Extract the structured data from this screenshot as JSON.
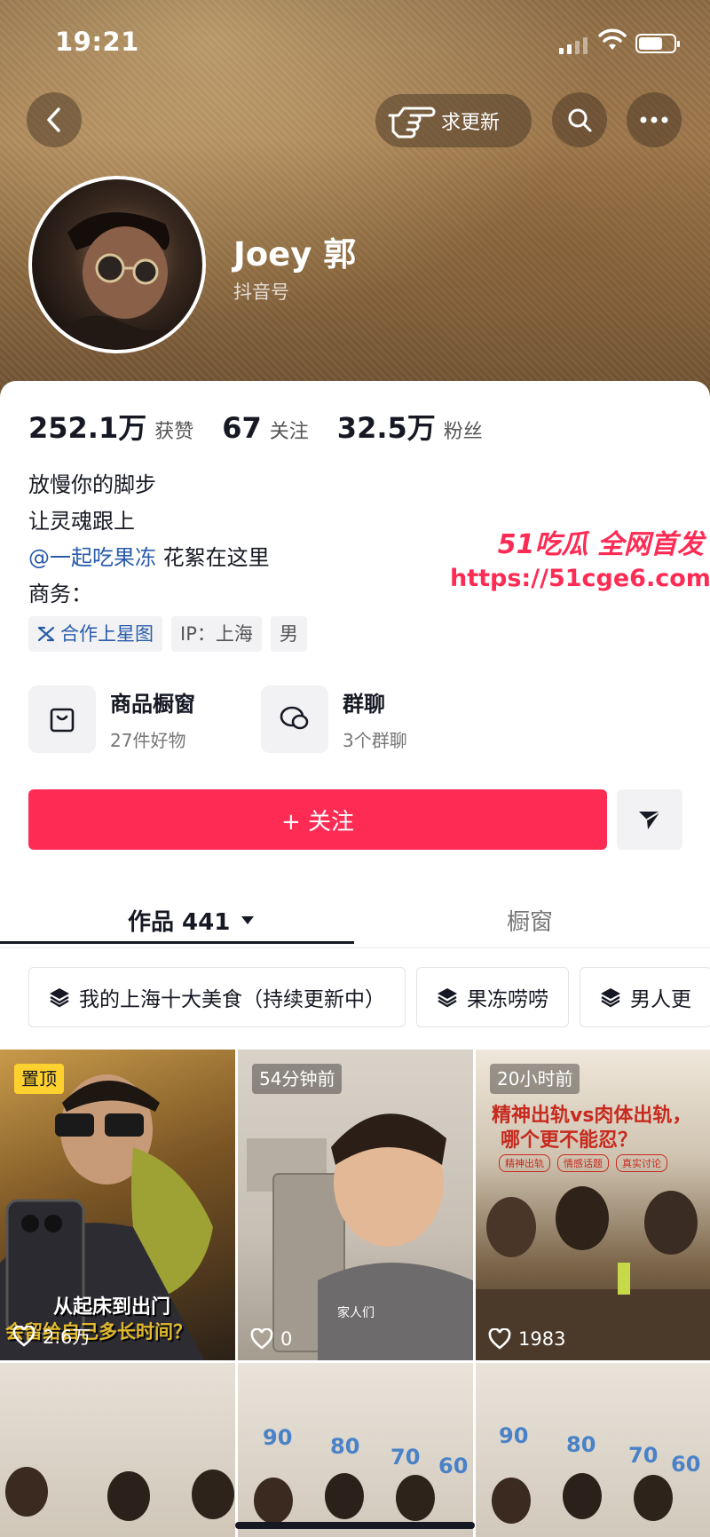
{
  "status": {
    "time": "19:21"
  },
  "header": {
    "request_update_label": "求更新",
    "username": "Joey 郭",
    "douyin_id_label": "抖音号"
  },
  "stats": [
    {
      "value": "252.1万",
      "label": "获赞"
    },
    {
      "value": "67",
      "label": "关注"
    },
    {
      "value": "32.5万",
      "label": "粉丝"
    }
  ],
  "bio": {
    "line1": "放慢你的脚步",
    "line2": "让灵魂跟上",
    "mention": "@一起吃果冻",
    "mention_suffix": " 花絮在这里",
    "business": "商务："
  },
  "tags": {
    "star": "合作上星图",
    "ip": "IP：上海",
    "gender": "男"
  },
  "features": {
    "shop": {
      "title": "商品橱窗",
      "subtitle": "27件好物"
    },
    "group": {
      "title": "群聊",
      "subtitle": "3个群聊"
    }
  },
  "follow_label": "+ 关注",
  "tabs": {
    "works": "作品 441",
    "showcase": "橱窗"
  },
  "chips": [
    "我的上海十大美食（持续更新中）",
    "果冻唠唠",
    "男人更"
  ],
  "videos": [
    {
      "badge": "置顶",
      "caption": "从起床到出门",
      "caption2": "会留给自己多长时间？",
      "likes": "2.6万"
    },
    {
      "badge": "54分钟前",
      "caption": "家人们",
      "likes": "0"
    },
    {
      "badge": "20小时前",
      "caption": "精神出轨vs肉体出轨，",
      "caption2": "哪个更不能忍？",
      "pills": [
        "精神出轨",
        "情感话题",
        "真实讨论"
      ],
      "likes": "1983"
    }
  ],
  "scores": {
    "a": "90",
    "b": "80",
    "c": "70",
    "d": "60"
  },
  "watermark": {
    "line1": "51吃瓜 全网首发",
    "line2": "https://51cge6.com"
  },
  "colors": {
    "accent": "#fe2c55",
    "link": "#2a5caa",
    "badge_pinned": "#ffd12e"
  }
}
